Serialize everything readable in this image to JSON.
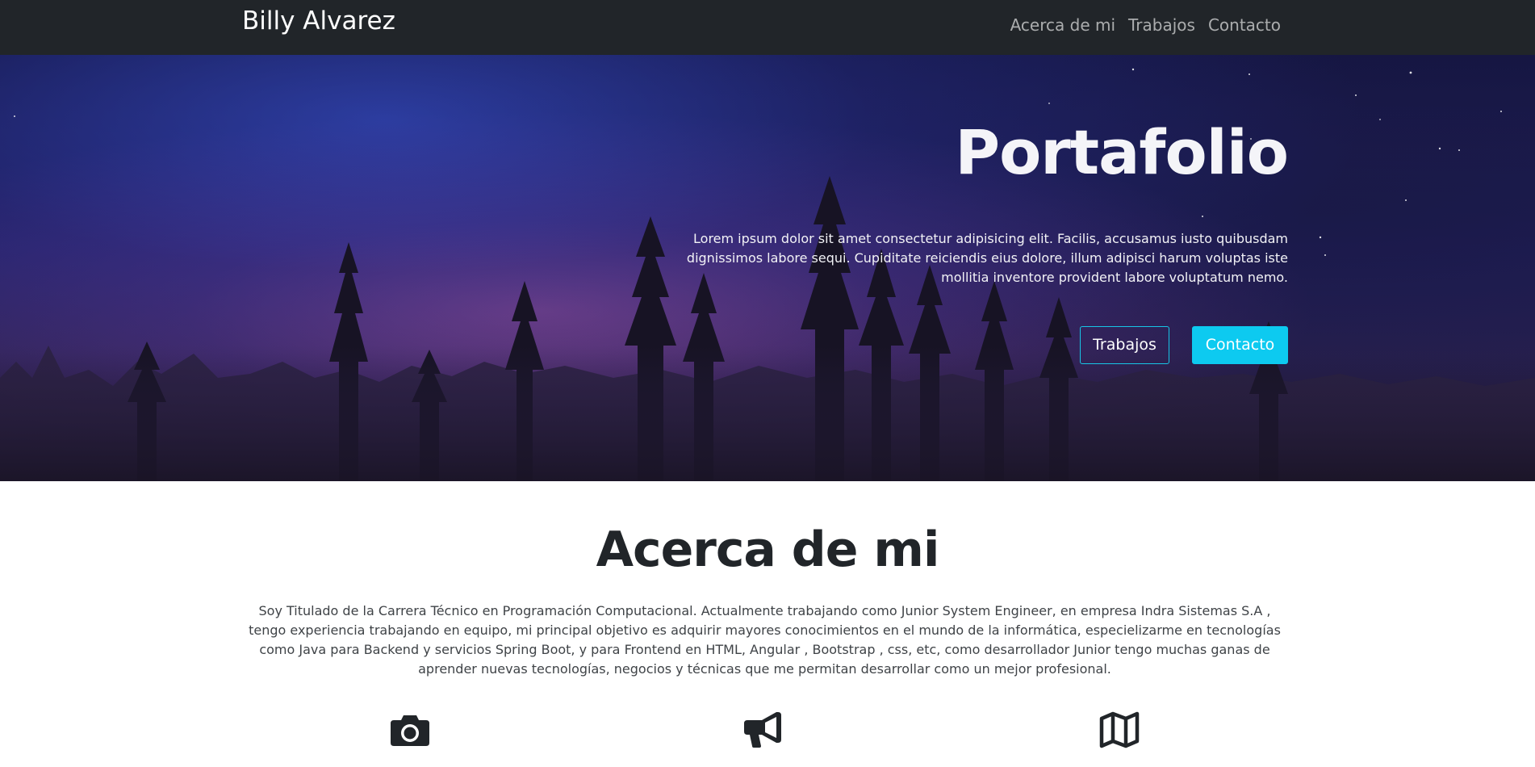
{
  "navbar": {
    "brand": "Billy Alvarez",
    "links": [
      "Acerca de mi",
      "Trabajos",
      "Contacto"
    ]
  },
  "hero": {
    "title": "Portafolio",
    "text": "Lorem ipsum dolor sit amet consectetur adipisicing elit. Facilis, accusamus iusto quibusdam dignissimos labore sequi. Cupiditate reiciendis eius dolore, illum adipisci harum voluptas iste mollitia inventore provident labore voluptatum nemo.",
    "buttons": {
      "works": "Trabajos",
      "contact": "Contacto"
    }
  },
  "about": {
    "title": "Acerca de mi",
    "text": "Soy Titulado de la Carrera Técnico en Programación Computacional. Actualmente trabajando como Junior System Engineer, en empresa Indra Sistemas S.A , tengo experiencia trabajando en equipo, mi principal objetivo es adquirir mayores conocimientos en el mundo de la informática, especielizarme en tecnologías como Java para Backend y servicios Spring Boot, y para Frontend en HTML, Angular , Bootstrap , css, etc, como desarrollador Junior tengo muchas ganas de aprender nuevas tecnologías, negocios y técnicas que me permitan desarrollar como un mejor profesional.",
    "icons": [
      "camera-icon",
      "bullhorn-icon",
      "map-icon"
    ]
  },
  "colors": {
    "navbar": "#212529",
    "accent": "#0dcaf0",
    "heading": "#212529"
  }
}
